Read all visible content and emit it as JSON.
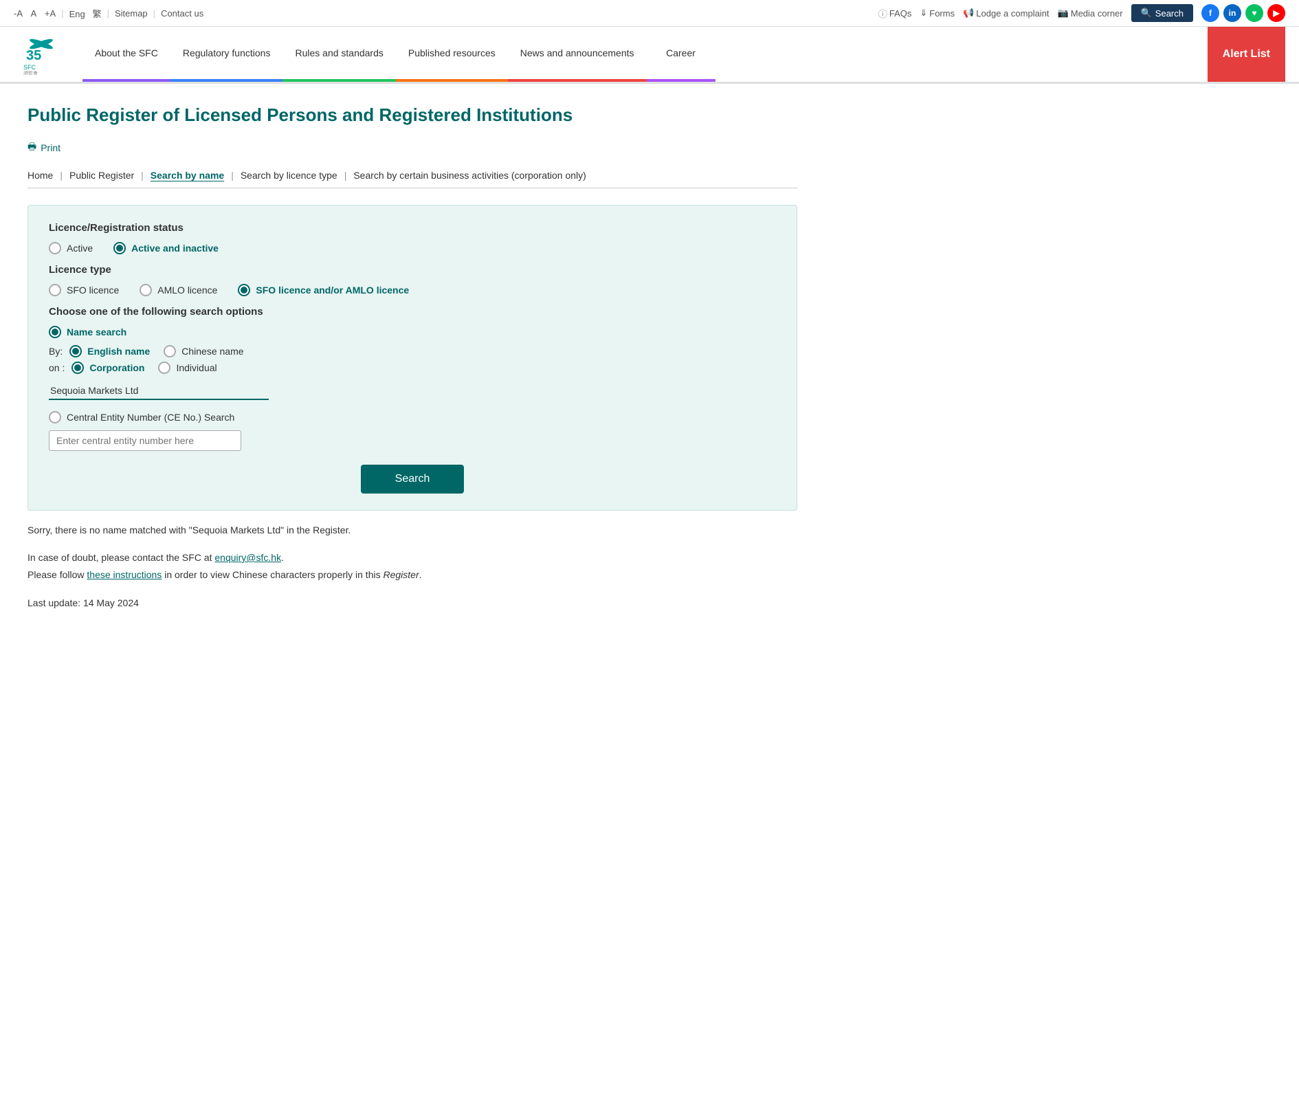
{
  "topbar": {
    "font_decrease": "-A",
    "font_normal": "A",
    "font_increase": "+A",
    "lang_eng": "Eng",
    "lang_trad": "繁",
    "sitemap": "Sitemap",
    "contact_us": "Contact us",
    "faqs": "FAQs",
    "forms": "Forms",
    "lodge_complaint": "Lodge a complaint",
    "media_corner": "Media corner",
    "search_btn": "Search"
  },
  "nav": {
    "about": "About the SFC",
    "regulatory": "Regulatory functions",
    "rules": "Rules and standards",
    "published": "Published resources",
    "news": "News and announcements",
    "career": "Career",
    "alert": "Alert List"
  },
  "page": {
    "title": "Public Register of Licensed Persons and Registered Institutions",
    "print": "Print"
  },
  "breadcrumb": {
    "home": "Home",
    "public_register": "Public Register",
    "search_by_name": "Search by name",
    "search_by_licence": "Search by licence type",
    "search_by_business": "Search by certain business activities (corporation only)"
  },
  "form": {
    "status_label": "Licence/Registration status",
    "status_active": "Active",
    "status_active_inactive": "Active and inactive",
    "licence_label": "Licence type",
    "licence_sfo": "SFO licence",
    "licence_amlo": "AMLO licence",
    "licence_both": "SFO licence and/or AMLO licence",
    "search_options_label": "Choose one of the following search options",
    "name_search": "Name search",
    "by_label": "By:",
    "english_name": "English name",
    "chinese_name": "Chinese name",
    "on_label": "on :",
    "corporation": "Corporation",
    "individual": "Individual",
    "search_input_value": "Sequoia Markets Ltd",
    "ce_search_label": "Central Entity Number (CE No.) Search",
    "ce_placeholder": "Enter central entity number here",
    "search_button": "Search"
  },
  "results": {
    "error_msg": "Sorry, there is no name matched with \"Sequoia Markets Ltd\" in the Register."
  },
  "info": {
    "line1_pre": "In case of doubt, please contact the SFC at ",
    "email": "enquiry@sfc.hk",
    "line1_post": ".",
    "line2_pre": "Please follow ",
    "instructions_link": "these instructions",
    "line2_post": " in order to view Chinese characters properly in this ",
    "register_italic": "Register",
    "line2_end": ".",
    "last_update": "Last update: 14 May 2024"
  }
}
